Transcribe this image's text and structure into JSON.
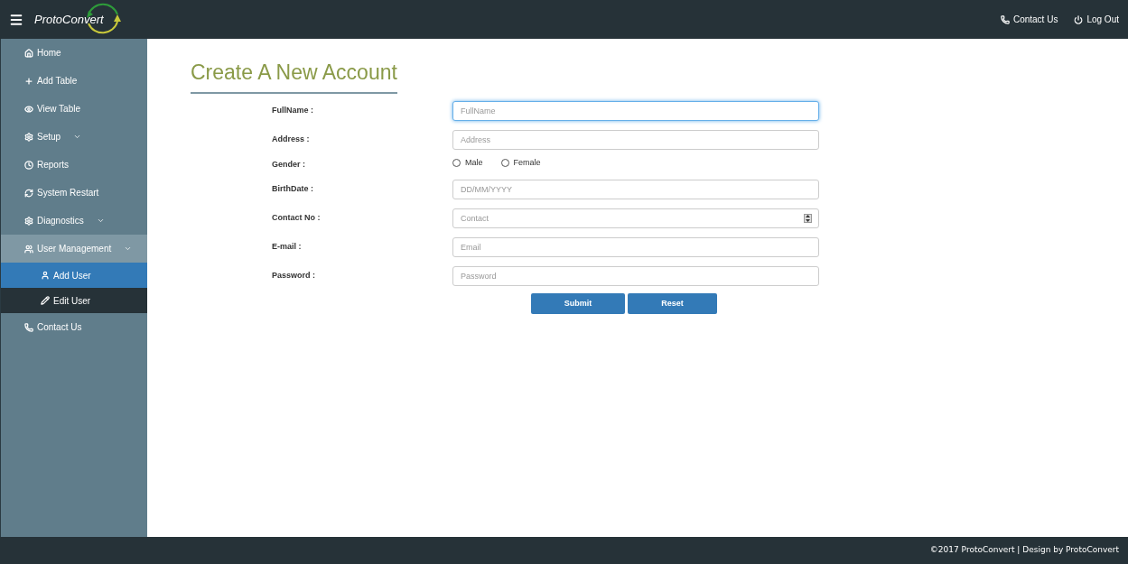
{
  "header": {
    "logo": "ProtoConvert",
    "links": [
      "Contact Us",
      "Log Out"
    ]
  },
  "sidebar": {
    "items": [
      {
        "label": "Home",
        "expandable": false,
        "expanded": false
      },
      {
        "label": "Add Table",
        "expandable": false,
        "expanded": false
      },
      {
        "label": "View Table",
        "expandable": false,
        "expanded": false
      },
      {
        "label": "Setup",
        "expandable": true,
        "expanded": false
      },
      {
        "label": "Reports",
        "expandable": false,
        "expanded": false
      },
      {
        "label": "System Restart",
        "expandable": false,
        "expanded": false
      },
      {
        "label": "Diagnostics",
        "expandable": true,
        "expanded": false
      },
      {
        "label": "User Management",
        "expandable": true,
        "expanded": true,
        "children": [
          {
            "label": "Add User",
            "selected": true
          },
          {
            "label": "Edit User",
            "selected": false
          }
        ]
      },
      {
        "label": "Contact Us",
        "expandable": false,
        "expanded": false
      }
    ]
  },
  "form": {
    "title": "Create A New Account",
    "fields": [
      {
        "kind": "text",
        "label": "FullName :",
        "placeholder": "FullName",
        "focused": true
      },
      {
        "kind": "text",
        "label": "Address :",
        "placeholder": "Address",
        "focused": false
      },
      {
        "kind": "radio",
        "label": "Gender :",
        "options": [
          {
            "label": "Male",
            "selected": false
          },
          {
            "label": "Female",
            "selected": false
          }
        ]
      },
      {
        "kind": "text",
        "label": "BirthDate :",
        "placeholder": "DD/MM/YYYY",
        "focused": false
      },
      {
        "kind": "number",
        "label": "Contact No :",
        "placeholder": "Contact",
        "focused": false
      },
      {
        "kind": "text",
        "label": "E-mail :",
        "placeholder": "Email",
        "focused": false
      },
      {
        "kind": "text",
        "label": "Password :",
        "placeholder": "Password",
        "focused": false
      }
    ],
    "buttons": [
      "Submit",
      "Reset"
    ]
  },
  "footer": "©2017 ProtoConvert | Design by ProtoConvert"
}
